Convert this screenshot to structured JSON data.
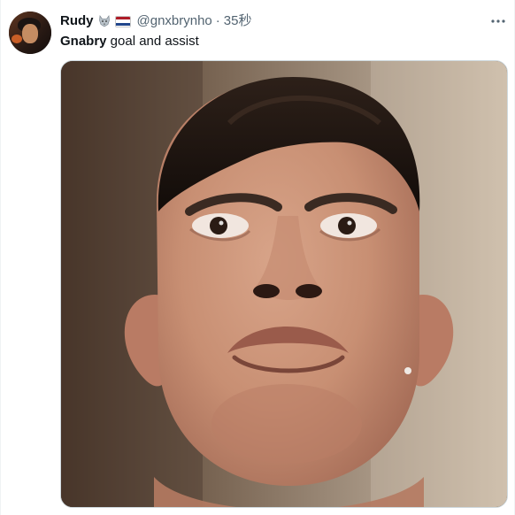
{
  "tweet": {
    "display_name": "Rudy",
    "emoji": [
      "wolf-icon",
      "netherlands-flag-icon"
    ],
    "handle": "@gnxbrynho",
    "separator": "·",
    "timestamp": "35秒",
    "text_bold": "Gnabry",
    "text_rest": " goal and assist",
    "more_icon": "more-options-icon",
    "media": {
      "type": "photo",
      "alt": ""
    }
  },
  "colors": {
    "primary_text": "#0f1419",
    "secondary_text": "#536471",
    "border": "#cfd9de"
  }
}
